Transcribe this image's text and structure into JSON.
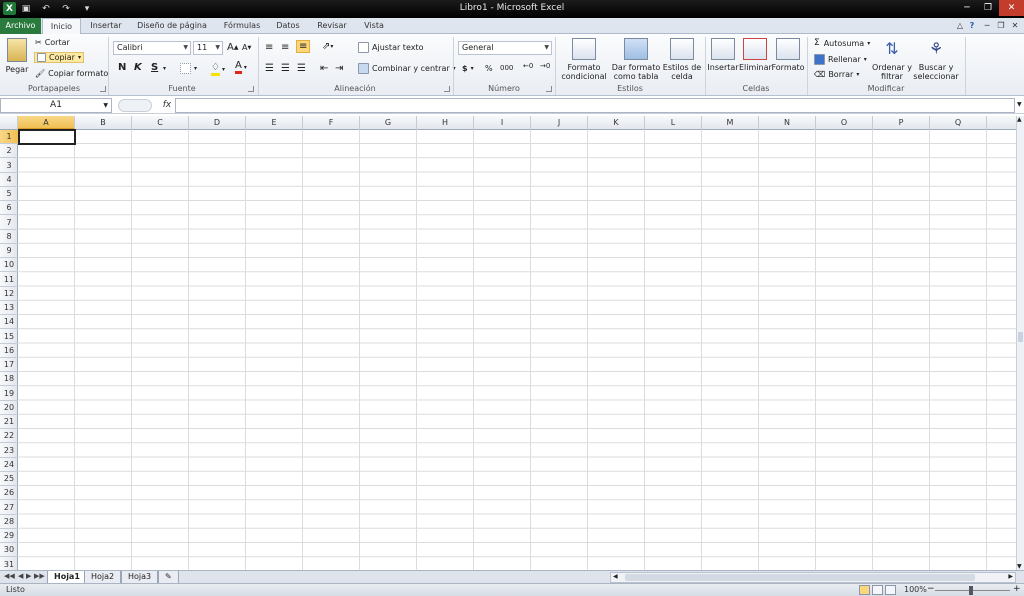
{
  "titlebar": {
    "title": "Libro1 - Microsoft Excel",
    "app_icon": "X"
  },
  "tabs": [
    "Archivo",
    "Inicio",
    "Insertar",
    "Diseño de página",
    "Fórmulas",
    "Datos",
    "Revisar",
    "Vista"
  ],
  "ribbon": {
    "clipboard": {
      "paste": "Pegar",
      "cut": "Cortar",
      "copy": "Copiar",
      "format_painter": "Copiar formato",
      "label": "Portapapeles"
    },
    "font": {
      "name": "Calibri",
      "size": "11",
      "bold": "N",
      "italic": "K",
      "underline": "S",
      "label": "Fuente"
    },
    "alignment": {
      "wrap": "Ajustar texto",
      "merge": "Combinar y centrar",
      "label": "Alineación"
    },
    "number": {
      "format": "General",
      "currency": "$",
      "percent": "%",
      "thousands": "000",
      "label": "Número"
    },
    "styles": {
      "conditional": "Formato condicional",
      "as_table": "Dar formato como tabla",
      "cell_styles": "Estilos de celda",
      "label": "Estilos"
    },
    "cells": {
      "insert": "Insertar",
      "delete": "Eliminar",
      "format": "Formato",
      "label": "Celdas"
    },
    "editing": {
      "autosum": "Autosuma",
      "fill": "Rellenar",
      "clear": "Borrar",
      "sort": "Ordenar y filtrar",
      "find": "Buscar y seleccionar",
      "label": "Modificar"
    }
  },
  "formula_bar": {
    "name_box": "A1",
    "fx": "fx",
    "value": ""
  },
  "columns": [
    "A",
    "B",
    "C",
    "D",
    "E",
    "F",
    "G",
    "H",
    "I",
    "J",
    "K",
    "L",
    "M",
    "N",
    "O",
    "P",
    "Q"
  ],
  "rows": [
    "1",
    "2",
    "3",
    "4",
    "5",
    "6",
    "7",
    "8",
    "9",
    "10",
    "11",
    "12",
    "13",
    "14",
    "15",
    "16",
    "17",
    "18",
    "19",
    "20",
    "21",
    "22",
    "23",
    "24",
    "25",
    "26",
    "27",
    "28",
    "29",
    "30",
    "31"
  ],
  "sheets": [
    "Hoja1",
    "Hoja2",
    "Hoja3"
  ],
  "status": {
    "text": "Listo",
    "zoom": "100%"
  }
}
